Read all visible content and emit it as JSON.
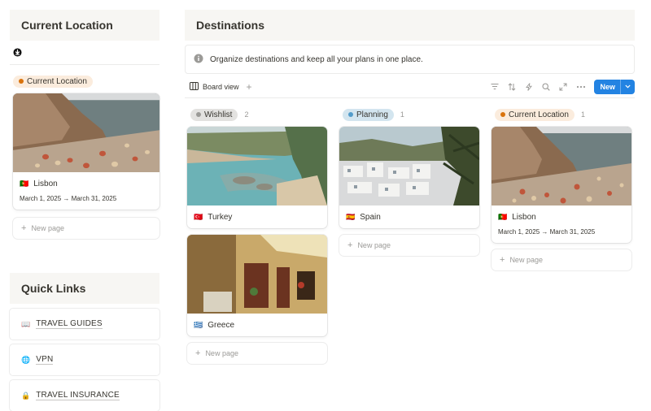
{
  "left": {
    "current_location": {
      "title": "Current Location",
      "tag": "Current Location",
      "card": {
        "flag": "🇵🇹",
        "name": "Lisbon",
        "dates": "March 1, 2025 → March 31, 2025"
      },
      "new_page": "New page"
    },
    "quick_links": {
      "title": "Quick Links",
      "items": [
        {
          "icon": "book-icon",
          "emoji": "📖",
          "label": "TRAVEL GUIDES"
        },
        {
          "icon": "globe-icon",
          "emoji": "🌐",
          "label": "VPN"
        },
        {
          "icon": "lock-icon",
          "emoji": "🔒",
          "label": "TRAVEL INSURANCE"
        }
      ]
    }
  },
  "destinations": {
    "title": "Destinations",
    "info": "Organize destinations and keep all your plans in one place.",
    "view_label": "Board view",
    "new_button": "New",
    "columns": [
      {
        "status": "Wishlist",
        "count": "2",
        "cards": [
          {
            "flag": "🇹🇷",
            "name": "Turkey"
          },
          {
            "flag": "🇬🇷",
            "name": "Greece"
          }
        ],
        "new_page": "New page"
      },
      {
        "status": "Planning",
        "count": "1",
        "cards": [
          {
            "flag": "🇪🇸",
            "name": "Spain"
          }
        ],
        "new_page": "New page"
      },
      {
        "status": "Current Location",
        "count": "1",
        "cards": [
          {
            "flag": "🇵🇹",
            "name": "Lisbon",
            "dates": "March 1, 2025 → March 31, 2025"
          }
        ],
        "new_page": "New page"
      }
    ]
  },
  "colors": {
    "accent": "#2383e2",
    "header_bg": "#f7f6f3",
    "tag_current": "#fbecdd",
    "tag_wishlist": "#e3e2e0",
    "tag_planning": "#d3e5ef"
  }
}
